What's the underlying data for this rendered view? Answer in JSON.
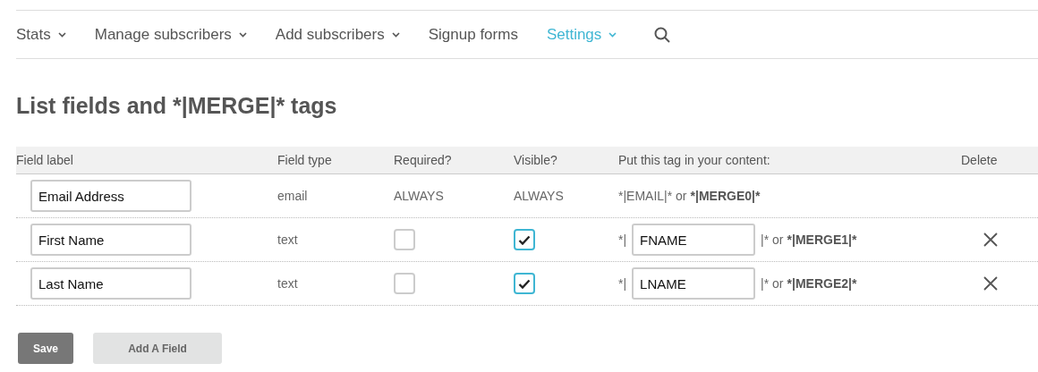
{
  "nav": {
    "items": [
      {
        "label": "Stats",
        "dropdown": true,
        "selected": false
      },
      {
        "label": "Manage subscribers",
        "dropdown": true,
        "selected": false
      },
      {
        "label": "Add subscribers",
        "dropdown": true,
        "selected": false
      },
      {
        "label": "Signup forms",
        "dropdown": false,
        "selected": false
      },
      {
        "label": "Settings",
        "dropdown": true,
        "selected": true
      }
    ]
  },
  "heading": "List fields and *|MERGE|* tags",
  "table": {
    "columns": [
      "Field label",
      "Field type",
      "Required?",
      "Visible?",
      "Put this tag in your content:",
      "Delete"
    ],
    "rows": [
      {
        "kind": "fixed",
        "label": "Email Address",
        "type": "email",
        "required": "ALWAYS",
        "visible": "ALWAYS",
        "tag_text": "*|EMAIL|* or",
        "merge": "*|MERGE0|*"
      },
      {
        "kind": "editable",
        "label": "First Name",
        "type": "text",
        "required": false,
        "visible": true,
        "tag_prefix": "*|",
        "tag": "FNAME",
        "tag_suffix": "|* or",
        "merge": "*|MERGE1|*"
      },
      {
        "kind": "editable",
        "label": "Last Name",
        "type": "text",
        "required": false,
        "visible": true,
        "tag_prefix": "*|",
        "tag": "LNAME",
        "tag_suffix": "|* or",
        "merge": "*|MERGE2|*"
      }
    ]
  },
  "buttons": [
    {
      "label": "Save",
      "disabled": false
    },
    {
      "label": "Add A Field",
      "disabled": true
    }
  ]
}
